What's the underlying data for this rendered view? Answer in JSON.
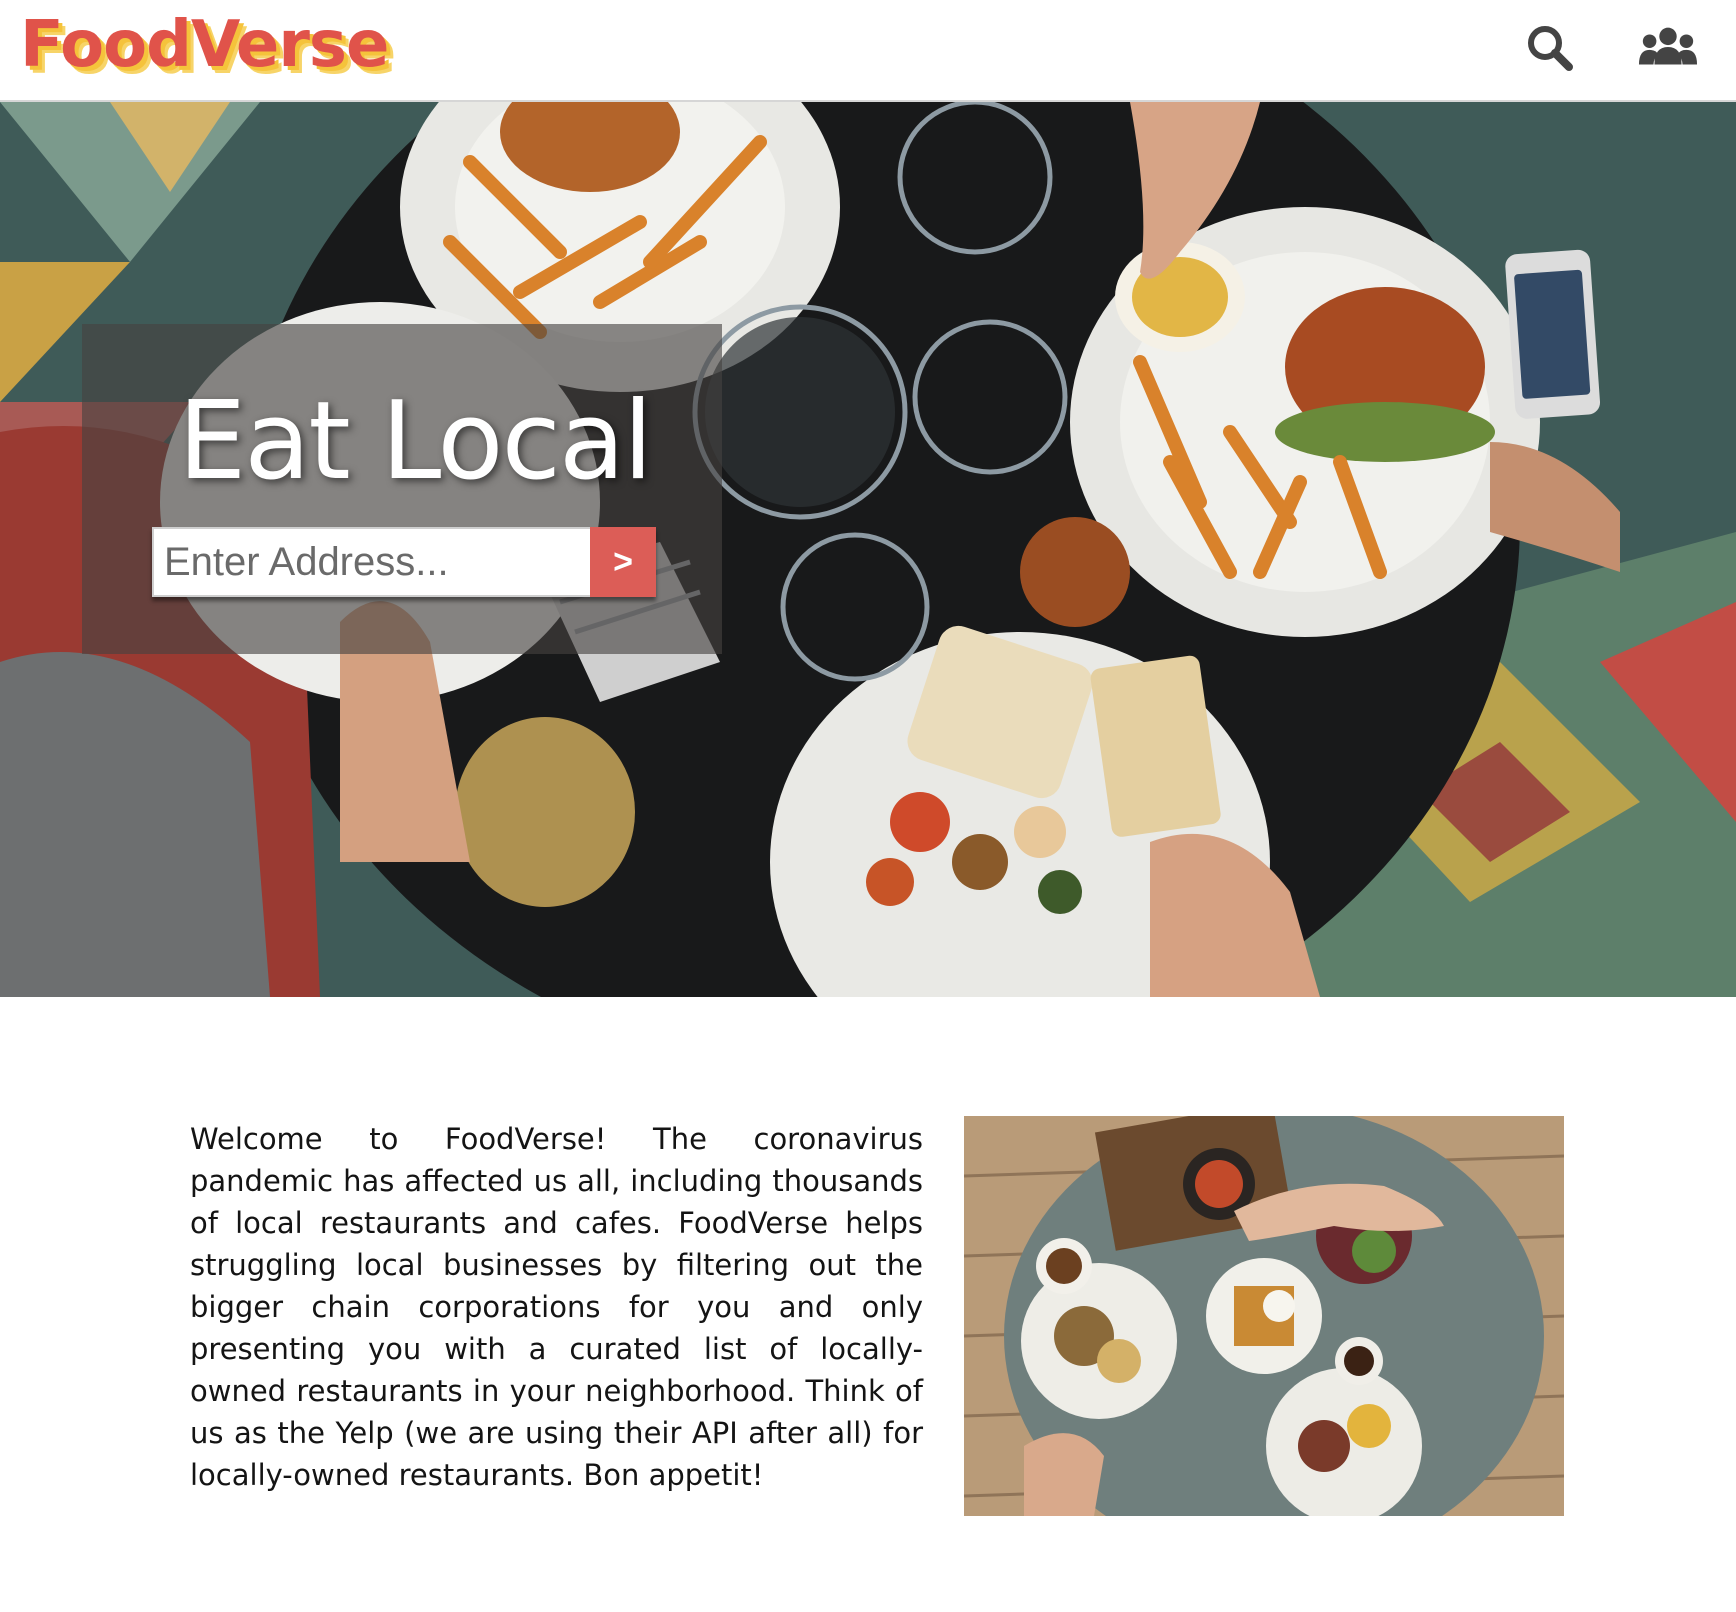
{
  "header": {
    "logo_text": "FoodVerse",
    "search_icon": "search-icon",
    "users_icon": "users-icon"
  },
  "hero": {
    "title": "Eat Local",
    "address_placeholder": "Enter Address...",
    "address_value": "",
    "submit_label": ">"
  },
  "about": {
    "text": "Welcome to FoodVerse! The coronavirus pandemic has affected us all, including thousands of local restaurants and cafes. FoodVerse helps struggling local businesses by filtering out the bigger chain corporations for you and only presenting you with a curated list of locally-owned restaurants in your neighborhood. Think of us as the Yelp (we are using their API after all) for locally-owned restaurants. Bon appetit!"
  },
  "colors": {
    "brand_red": "#e0534a",
    "brand_yellow": "#f5c33b",
    "button_red": "#dc5d57",
    "icon_gray": "#444444"
  }
}
